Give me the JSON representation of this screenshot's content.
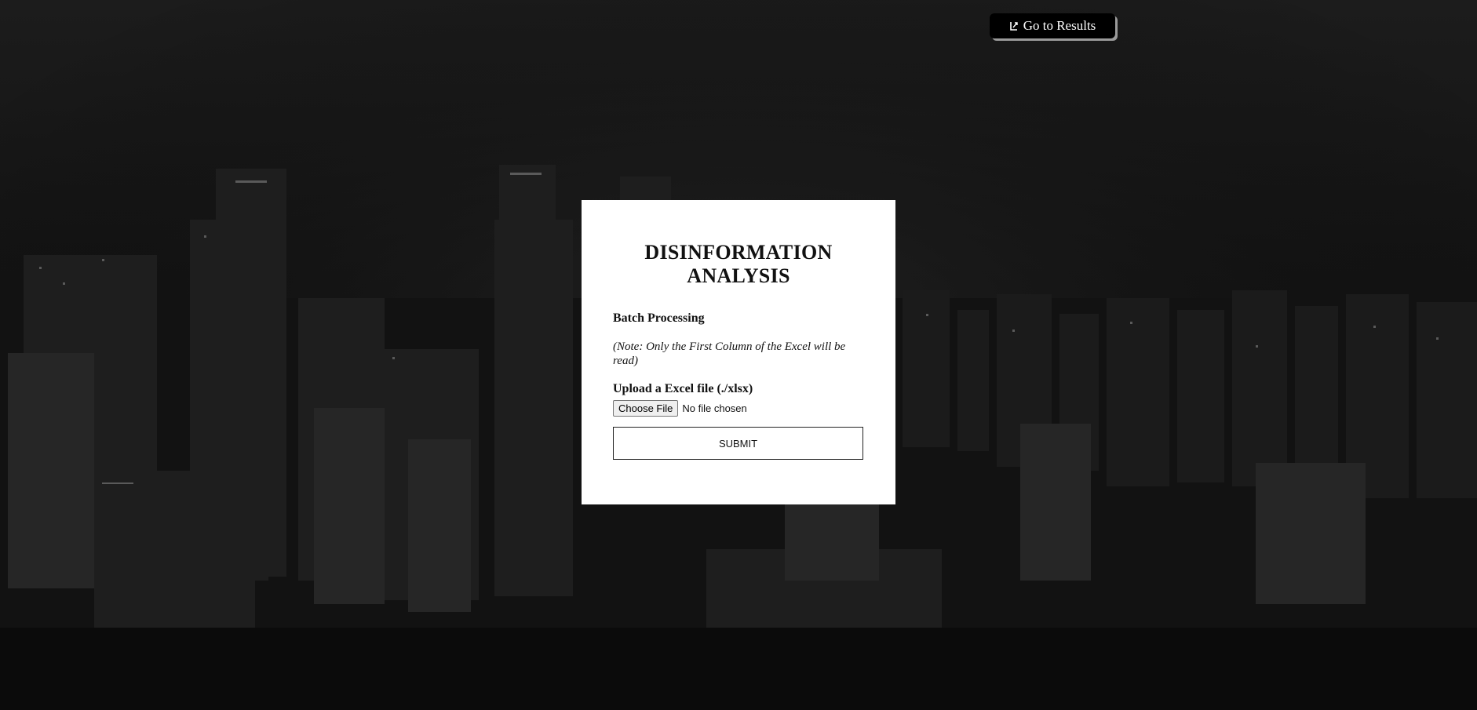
{
  "header": {
    "results_button_label": "Go to Results",
    "results_button_icon": "external-link-icon"
  },
  "card": {
    "title": "DISINFORMATION ANALYSIS",
    "section_heading": "Batch Processing",
    "note": "(Note: Only the First Column of the Excel will be read)",
    "upload_label": "Upload a Excel file (./xlsx)",
    "file_input": {
      "button_label": "Choose File",
      "status": "No file chosen"
    },
    "submit_label": "SUBMIT"
  },
  "colors": {
    "page_background": "#0d0d0d",
    "card_background": "#ffffff",
    "button_background": "#000000",
    "button_shadow": "#9a9a9a"
  }
}
